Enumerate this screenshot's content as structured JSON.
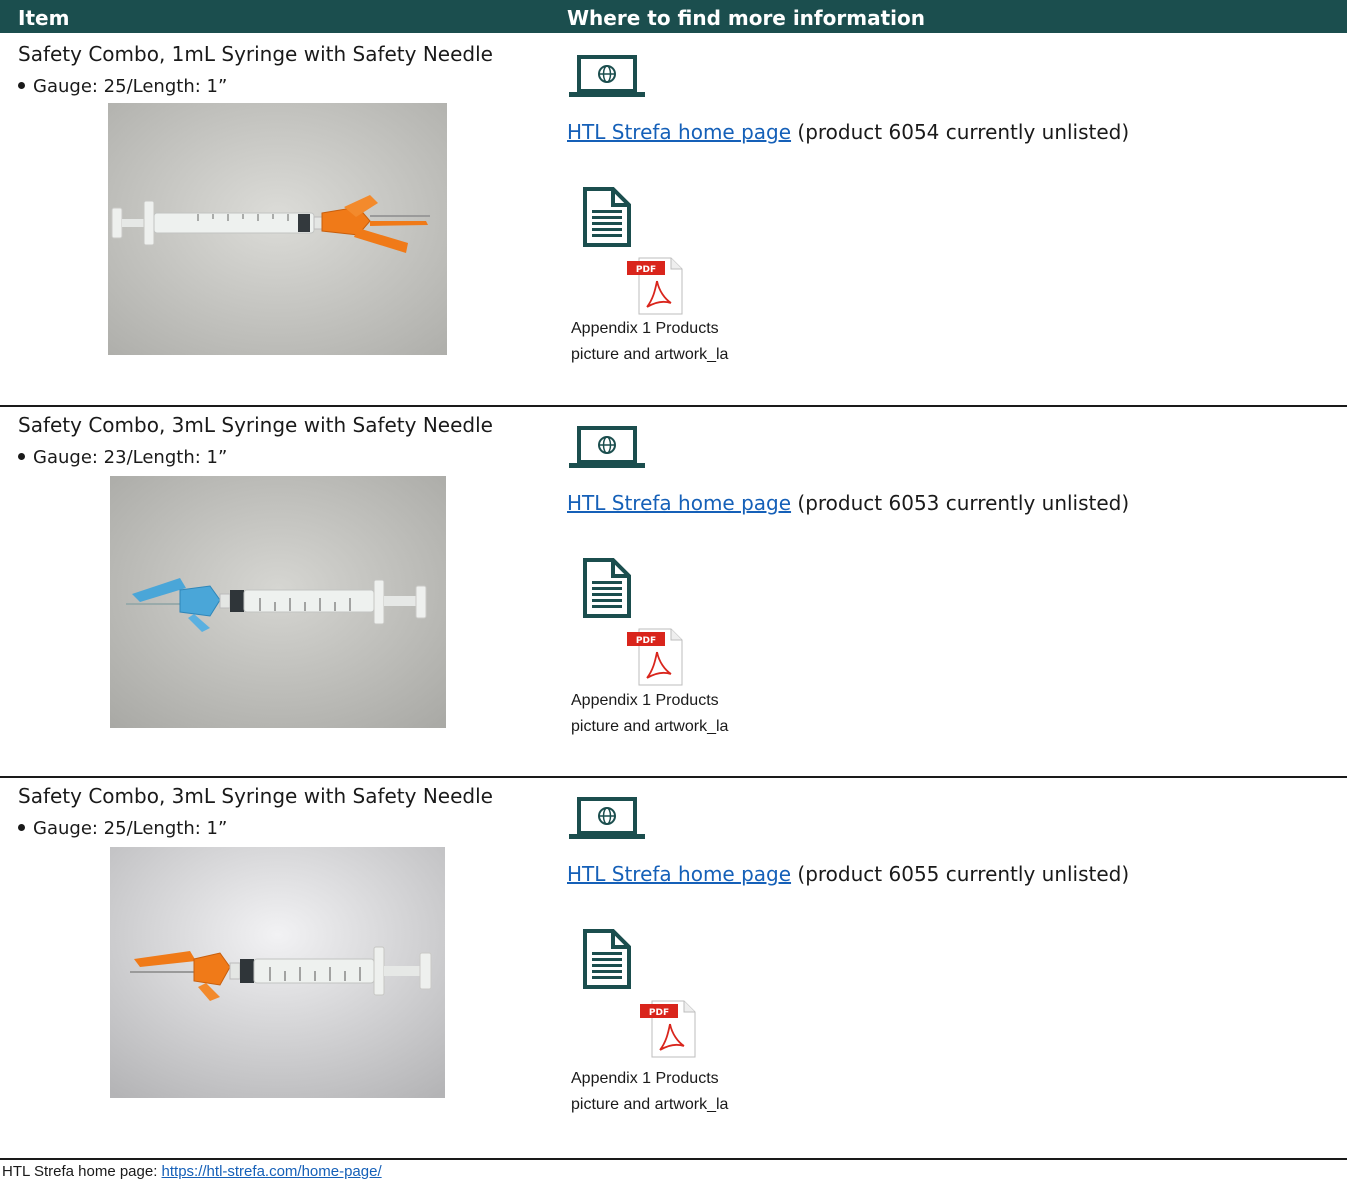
{
  "header": {
    "item": "Item",
    "info": "Where to find more information"
  },
  "rows": [
    {
      "title": "Safety Combo, 1mL Syringe with Safety Needle",
      "gauge": "Gauge: 25/Length: 1”",
      "link_text": "HTL Strefa home page",
      "link_suffix": " (product 6054 currently unlisted)",
      "pdf_caption_1": "Appendix 1 Products",
      "pdf_caption_2": "picture and artwork_la",
      "pdf_label": "PDF",
      "hub_color": "#f07a18"
    },
    {
      "title": "Safety Combo, 3mL Syringe with Safety Needle",
      "gauge": "Gauge: 23/Length: 1”",
      "link_text": "HTL Strefa home page",
      "link_suffix": " (product 6053 currently unlisted)",
      "pdf_caption_1": "Appendix 1 Products",
      "pdf_caption_2": "picture and artwork_la",
      "pdf_label": "PDF",
      "hub_color": "#4aa6d8"
    },
    {
      "title": "Safety Combo, 3mL Syringe with Safety Needle",
      "gauge": "Gauge: 25/Length: 1”",
      "link_text": "HTL Strefa home page",
      "link_suffix": " (product 6055 currently unlisted)",
      "pdf_caption_1": "Appendix 1 Products",
      "pdf_caption_2": "picture and artwork_la",
      "pdf_label": "PDF",
      "hub_color": "#f07a18"
    }
  ],
  "footer": {
    "label": "HTL Strefa home page: ",
    "url": "https://htl-strefa.com/home-page/"
  },
  "colors": {
    "header_bg": "#1b4e4e",
    "link": "#1560b8",
    "icon": "#1b4e4e"
  }
}
